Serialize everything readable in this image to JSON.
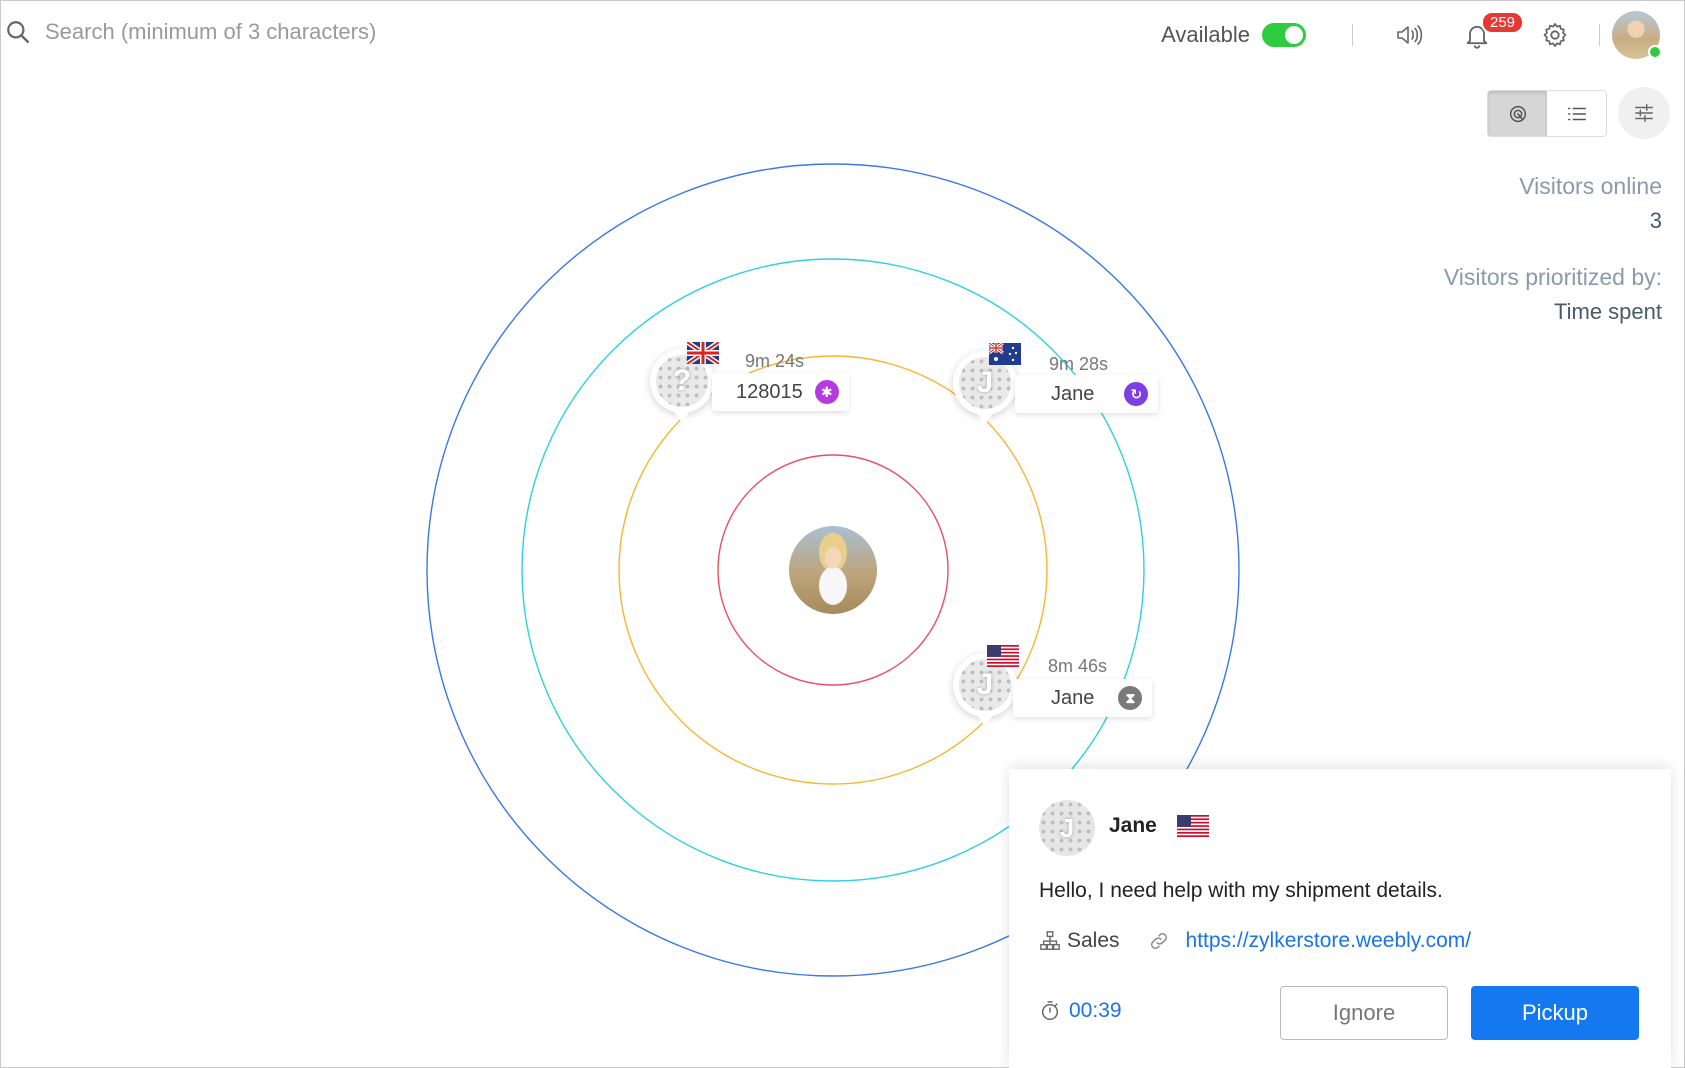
{
  "search": {
    "placeholder": "Search (minimum of 3 characters)"
  },
  "topbar": {
    "status_label": "Available",
    "status_on": true,
    "notification_count": "259",
    "accent_green": "#2ecc40",
    "badge_color": "#e53935"
  },
  "view": {
    "active": "radar"
  },
  "stats": {
    "online_label": "Visitors online",
    "online_value": "3",
    "prioritized_label": "Visitors prioritized by:",
    "prioritized_value": "Time spent"
  },
  "visitors": [
    {
      "glyph": "?",
      "flag": "uk-flag",
      "time": "9m 24s",
      "name": "128015",
      "status_icon": "asterisk-icon",
      "status_color": "#b43be0"
    },
    {
      "glyph": "J",
      "flag": "australia-flag",
      "time": "9m 28s",
      "name": "Jane",
      "status_icon": "redirect-icon",
      "status_color": "#7b3fe4"
    },
    {
      "glyph": "J",
      "flag": "usa-flag",
      "time": "8m 46s",
      "name": "Jane",
      "status_icon": "hourglass-icon",
      "status_color": "#7a7a7a"
    }
  ],
  "chat": {
    "glyph": "J",
    "name": "Jane",
    "flag": "usa-flag",
    "message": "Hello, I need help with my shipment details.",
    "department": "Sales",
    "url": "https://zylkerstore.weebly.com/",
    "timer": "00:39",
    "ignore_label": "Ignore",
    "pickup_label": "Pickup",
    "accent_blue": "#1479f0"
  }
}
